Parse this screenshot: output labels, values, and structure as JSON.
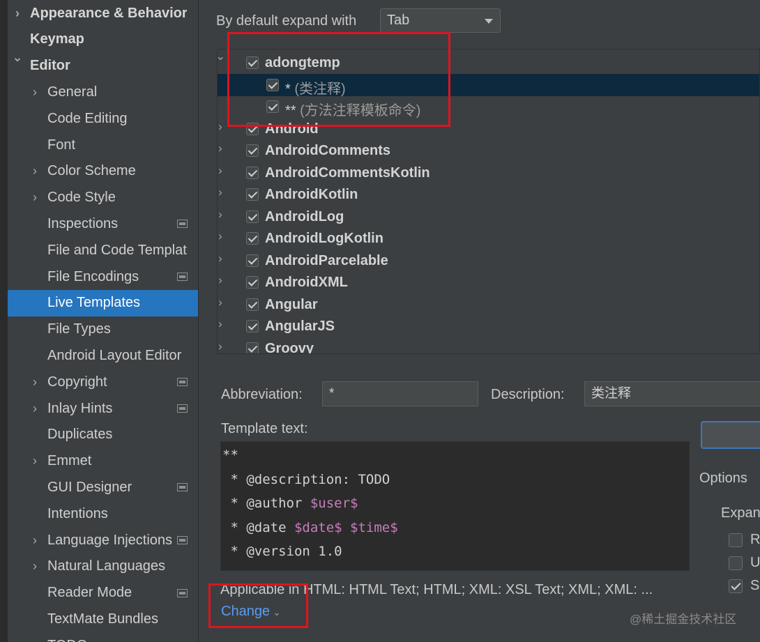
{
  "sidebar": {
    "items": [
      {
        "label": "Appearance & Behavior",
        "chevron": ">",
        "bold": true
      },
      {
        "label": "Keymap",
        "chevron": "",
        "bold": true
      },
      {
        "label": "Editor",
        "chevron": "v",
        "bold": true
      },
      {
        "label": "General",
        "chevron": ">"
      },
      {
        "label": "Code Editing",
        "chevron": ""
      },
      {
        "label": "Font",
        "chevron": ""
      },
      {
        "label": "Color Scheme",
        "chevron": ">"
      },
      {
        "label": "Code Style",
        "chevron": ">"
      },
      {
        "label": "Inspections",
        "chevron": "",
        "project_icon": true
      },
      {
        "label": "File and Code Templates",
        "chevron": ""
      },
      {
        "label": "File Encodings",
        "chevron": "",
        "project_icon": true
      },
      {
        "label": "Live Templates",
        "chevron": "",
        "selected": true
      },
      {
        "label": "File Types",
        "chevron": ""
      },
      {
        "label": "Android Layout Editor",
        "chevron": ""
      },
      {
        "label": "Copyright",
        "chevron": ">",
        "project_icon": true
      },
      {
        "label": "Inlay Hints",
        "chevron": ">",
        "project_icon": true
      },
      {
        "label": "Duplicates",
        "chevron": ""
      },
      {
        "label": "Emmet",
        "chevron": ">"
      },
      {
        "label": "GUI Designer",
        "chevron": "",
        "project_icon": true
      },
      {
        "label": "Intentions",
        "chevron": ""
      },
      {
        "label": "Language Injections",
        "chevron": ">",
        "project_icon": true
      },
      {
        "label": "Natural Languages",
        "chevron": ">"
      },
      {
        "label": "Reader Mode",
        "chevron": "",
        "project_icon": true
      },
      {
        "label": "TextMate Bundles",
        "chevron": ""
      },
      {
        "label": "TODO",
        "chevron": ""
      }
    ]
  },
  "expand": {
    "label": "By default expand with",
    "value": "Tab"
  },
  "tree": {
    "rows": [
      {
        "kind": "group",
        "label": "adongtemp",
        "chevron": "v",
        "checked": true
      },
      {
        "kind": "template",
        "abbr": "*",
        "desc": "(类注释)",
        "checked": true,
        "selected": true
      },
      {
        "kind": "template",
        "abbr": "**",
        "desc": "(方法注释模板命令)",
        "checked": true
      },
      {
        "kind": "group",
        "label": "Android",
        "chevron": ">",
        "checked": true
      },
      {
        "kind": "group",
        "label": "AndroidComments",
        "chevron": ">",
        "checked": true
      },
      {
        "kind": "group",
        "label": "AndroidCommentsKotlin",
        "chevron": ">",
        "checked": true
      },
      {
        "kind": "group",
        "label": "AndroidKotlin",
        "chevron": ">",
        "checked": true
      },
      {
        "kind": "group",
        "label": "AndroidLog",
        "chevron": ">",
        "checked": true
      },
      {
        "kind": "group",
        "label": "AndroidLogKotlin",
        "chevron": ">",
        "checked": true
      },
      {
        "kind": "group",
        "label": "AndroidParcelable",
        "chevron": ">",
        "checked": true
      },
      {
        "kind": "group",
        "label": "AndroidXML",
        "chevron": ">",
        "checked": true
      },
      {
        "kind": "group",
        "label": "Angular",
        "chevron": ">",
        "checked": true
      },
      {
        "kind": "group",
        "label": "AngularJS",
        "chevron": ">",
        "checked": true
      },
      {
        "kind": "group",
        "label": "Groovy",
        "chevron": ">",
        "checked": true
      }
    ]
  },
  "details": {
    "abbreviation_label": "Abbreviation:",
    "abbreviation_value": "*",
    "description_label": "Description:",
    "description_value": "类注释",
    "template_text_label": "Template text:",
    "template_lines": [
      [
        {
          "t": "**"
        }
      ],
      [
        {
          "t": " * @description: TODO"
        }
      ],
      [
        {
          "t": " * @author "
        },
        {
          "t": "$user$",
          "var": true
        }
      ],
      [
        {
          "t": " * @date "
        },
        {
          "t": "$date$",
          "var": true
        },
        {
          "t": " "
        },
        {
          "t": "$time$",
          "var": true
        }
      ],
      [
        {
          "t": " * @version 1.0"
        }
      ],
      [
        {
          "t": " */"
        }
      ]
    ],
    "applicable_text": "Applicable in HTML: HTML Text; HTML; XML: XSL Text; XML; XML: ...",
    "change_label": "Change",
    "options_label": "Options",
    "expand_label": "Expand",
    "option_checkboxes": [
      {
        "letter": "R",
        "checked": false
      },
      {
        "letter": "U",
        "checked": false
      },
      {
        "letter": "S",
        "checked": true
      }
    ]
  },
  "watermark": "@稀土掘金技术社区"
}
